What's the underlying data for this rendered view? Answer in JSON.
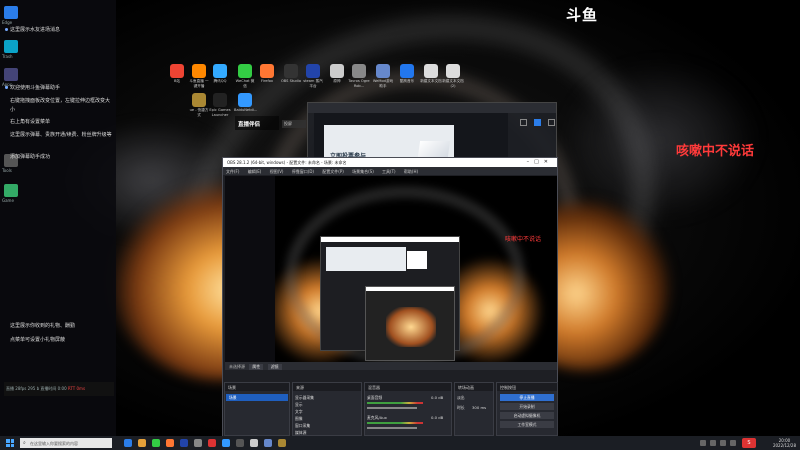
{
  "watermark": {
    "brand": "斗鱼"
  },
  "overlay": {
    "text": "咳嗽中不说话",
    "inner_text": "咳嗽中不说话"
  },
  "sidebar": {
    "messages": [
      "这里展示水友进场消息",
      "欢迎使用斗鱼弹幕助手",
      "右键拖拽面板改变位置，左键拉伸边框改变大小",
      "右上角有设置菜单",
      "这里展示弹幕、贵族开通/续费、粉丝牌升级等",
      "添加弹幕助手成功",
      "这里展示你收到的礼物、酬勤",
      "点菜单可设置小礼物屏蔽"
    ],
    "status_line": "直播 28fps 295 b  直播时间 0:00",
    "status_red": "RTT 0ms",
    "icon_labels": [
      "Edge",
      "Trash",
      "Apps",
      "Tools",
      "Game"
    ]
  },
  "desktop_icons": [
    {
      "label": "B站",
      "color": "#e43"
    },
    {
      "label": "斗鱼直播 一键开播",
      "color": "#f80"
    },
    {
      "label": "腾讯QQ",
      "color": "#3af"
    },
    {
      "label": "WeChat 微信",
      "color": "#3c4"
    },
    {
      "label": "Firefox",
      "color": "#f73"
    },
    {
      "label": "OBS Studio",
      "color": "#333"
    },
    {
      "label": "steam 蒸汽平台",
      "color": "#24a"
    },
    {
      "label": "原神",
      "color": "#ccc"
    },
    {
      "label": "Tavros Ogre Rob...",
      "color": "#888"
    },
    {
      "label": "WeMod游戏助手",
      "color": "#68c"
    },
    {
      "label": "酷狗音乐",
      "color": "#27e"
    },
    {
      "label": "新建文本文档",
      "color": "#ddd"
    },
    {
      "label": "新建文本文档 (2)",
      "color": "#ddd"
    },
    {
      "label": "ue - 快捷方式",
      "color": "#a83"
    },
    {
      "label": "Epic Games Launcher",
      "color": "#222"
    },
    {
      "label": "BaiduNetdi...",
      "color": "#39f"
    }
  ],
  "back_window": {
    "card_text": "立即投票参与",
    "brand_badge": "直播伴侣",
    "cast_badge": "投屏"
  },
  "obs": {
    "title": "OBS 28.1.2 (64-bit, windows) - 配置文件: 未命名 - 场景: 未命名",
    "menu": [
      "文件(F)",
      "编辑(E)",
      "视图(V)",
      "停靠窗口(D)",
      "配置文件(P)",
      "场景集合(S)",
      "工具(T)",
      "帮助(H)"
    ],
    "status_label": "未选择源",
    "status_buttons": [
      "属性",
      "滤镜"
    ],
    "docks": {
      "scenes": {
        "title": "场景",
        "items": [
          "场景"
        ]
      },
      "sources": {
        "title": "来源",
        "items": [
          "显示器采集",
          "显示",
          "文字",
          "图像",
          "窗口采集",
          "媒体源"
        ]
      },
      "mixer": {
        "title": "混音器",
        "tracks": [
          {
            "name": "桌面音频",
            "level": "0.0 dB"
          },
          {
            "name": "麦克风/Aux",
            "level": "0.0 dB"
          }
        ]
      },
      "transitions": {
        "title": "转场动画",
        "type": "淡出",
        "duration_label": "时长",
        "duration": "300 ms"
      },
      "controls": {
        "title": "控制按钮",
        "buttons": [
          "停止直播",
          "开始录制",
          "启动虚拟摄像机",
          "工作室模式",
          "设置",
          "退出"
        ]
      }
    }
  },
  "taskbar": {
    "search_placeholder": "在这里输入你要搜索的内容",
    "clock_time": "20:00",
    "clock_date": "2022/12/28",
    "ime": "S"
  },
  "colors": {
    "accent": "#1f5fbf",
    "overlay_red": "#ff3a3a"
  }
}
